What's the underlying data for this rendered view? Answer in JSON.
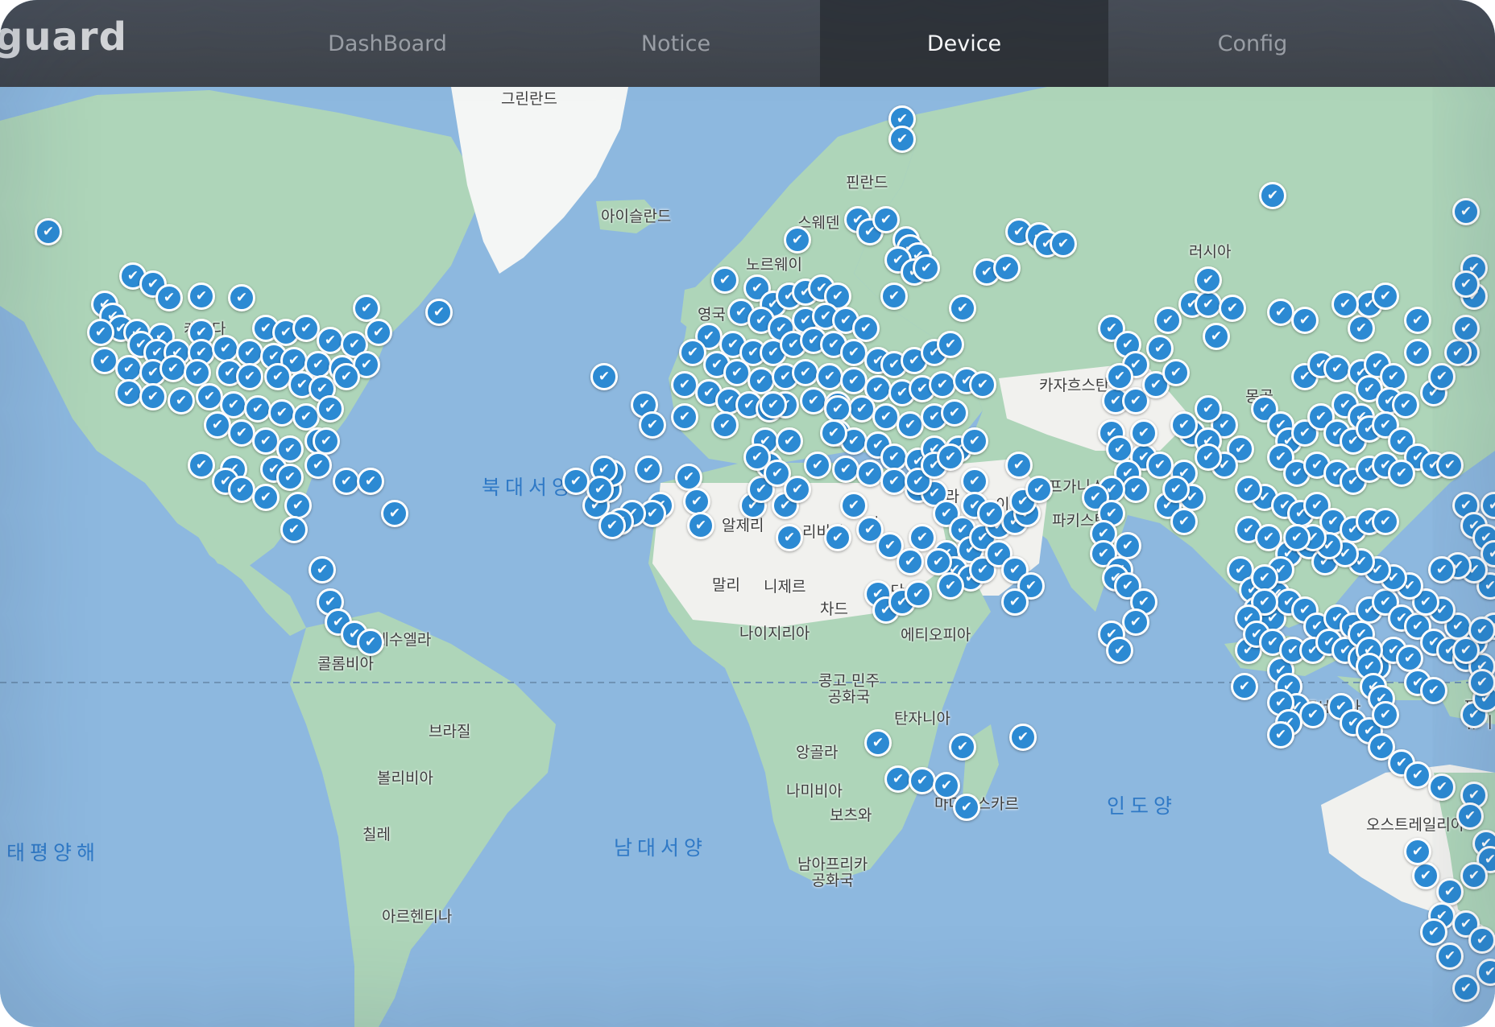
{
  "app": {
    "logo_text": "guard"
  },
  "nav": {
    "tabs": [
      {
        "label": "DashBoard",
        "active": false
      },
      {
        "label": "Notice",
        "active": false
      },
      {
        "label": "Device",
        "active": true
      },
      {
        "label": "Config",
        "active": false
      }
    ]
  },
  "map": {
    "country_labels": {
      "greenland": "그린란드",
      "iceland": "아이슬란드",
      "finland": "핀란드",
      "sweden": "스웨덴",
      "norway": "노르웨이",
      "uk": "영국",
      "russia": "러시아",
      "canada": "캐나다",
      "kazakhstan": "카자흐스탄",
      "mongolia": "몽골",
      "afghanistan": "아프가니스탄",
      "pakistan": "파키스탄",
      "iran": "이란",
      "iraq": "이라",
      "algeria": "알제리",
      "libya": "리비아",
      "egypt": "이",
      "mali": "말리",
      "niger": "니제르",
      "chad": "차드",
      "sudan": "수단",
      "nigeria": "나이지리아",
      "ethiopia": "에티오피아",
      "venezuela": "베네수엘라",
      "colombia": "콜롬비아",
      "brazil": "브라질",
      "bolivia": "볼리비아",
      "chile": "칠레",
      "argentina": "아르헨티나",
      "drc": "콩고 민주\n공화국",
      "tanzania": "탄자니아",
      "angola": "앙골라",
      "namibia": "나미비아",
      "botswana": "보츠와",
      "madagascar": "마다가스카르",
      "south_africa": "남아프리카\n공화국",
      "indonesia": "인도네시아",
      "australia": "오스트레일리아",
      "papua": "파푸\n뉴기"
    },
    "ocean_labels": {
      "north_atlantic": "북대서양",
      "south_atlantic": "남대서양",
      "indian_ocean": "인도양",
      "pacific": "태평양해"
    },
    "pin_icon": "check-icon",
    "pin_color": "#2c8ad3",
    "land_color": "#aed5b9",
    "desert_color": "#f1f1ee",
    "ice_color": "#f4f6f5",
    "ocean_color": "#8db8df"
  }
}
